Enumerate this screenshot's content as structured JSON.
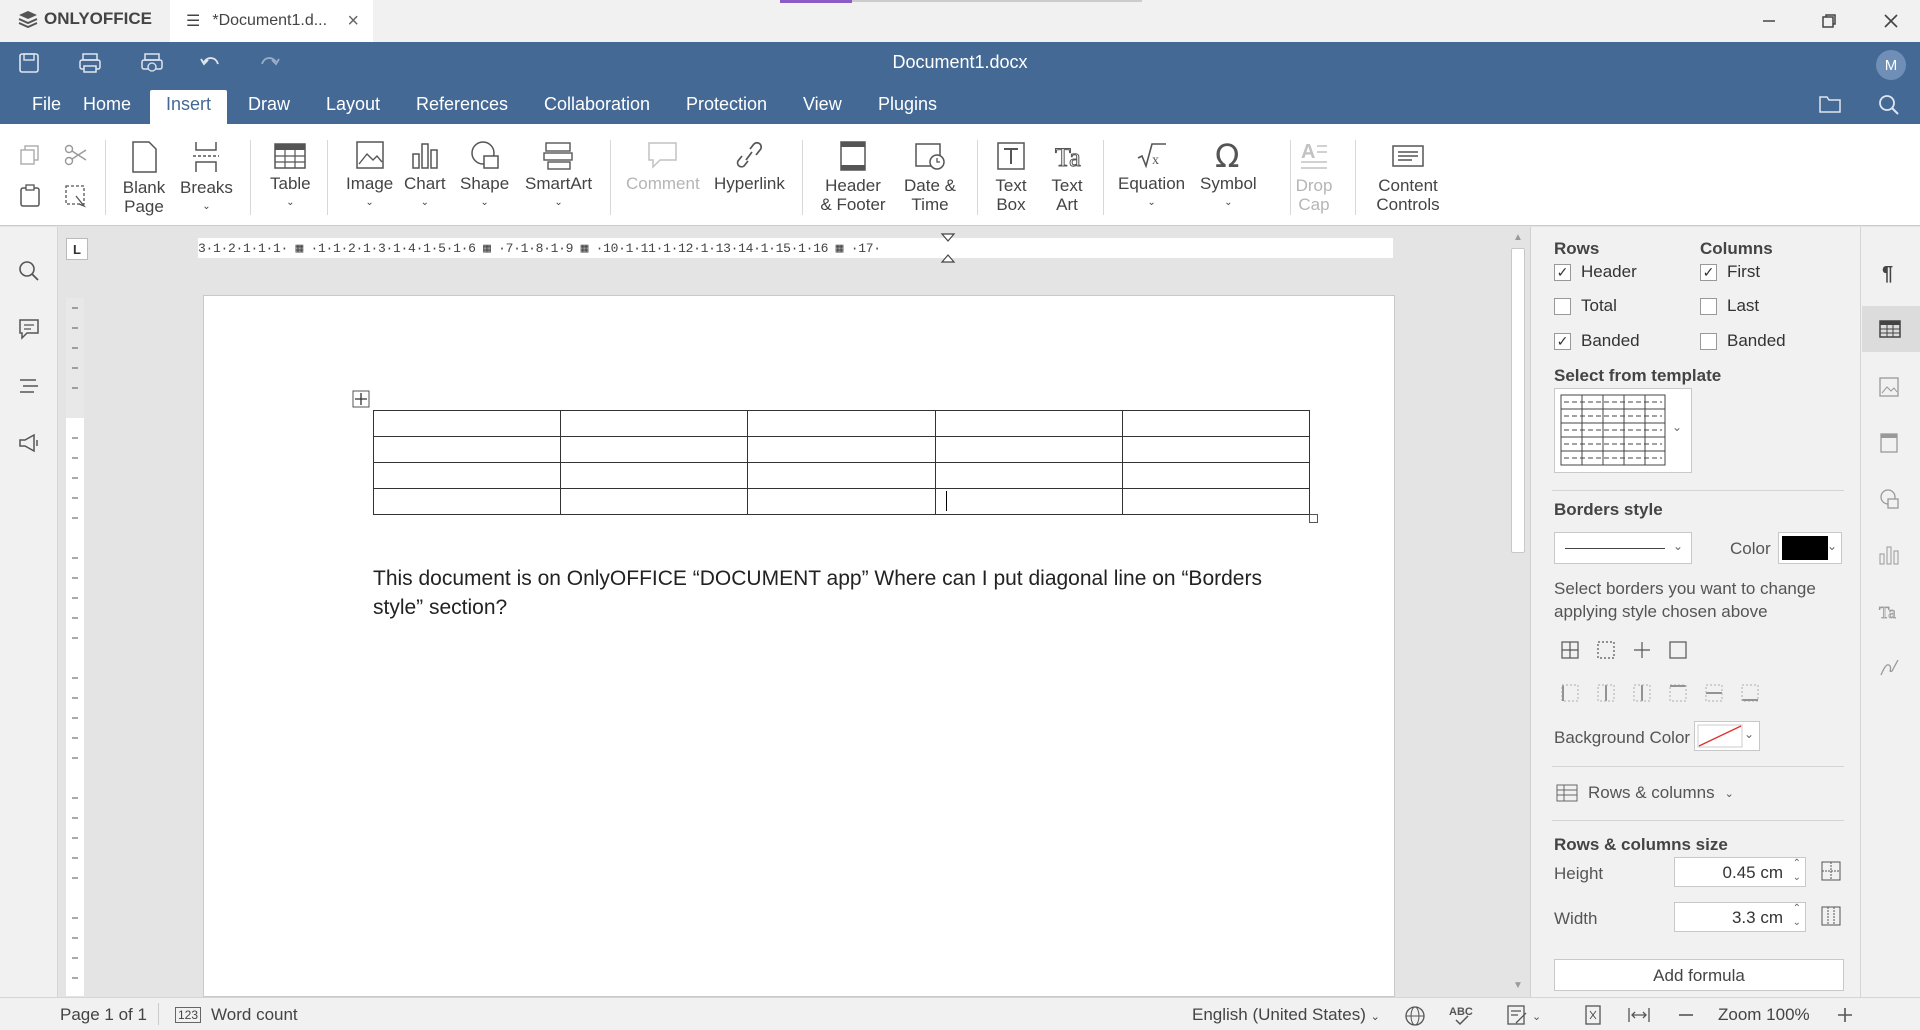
{
  "titlebar": {
    "brand": "ONLYOFFICE",
    "tab_title": "*Document1.d...",
    "close_tab": "×"
  },
  "header": {
    "doc_title": "Document1.docx",
    "avatar_initial": "M"
  },
  "tabs": [
    "File",
    "Home",
    "Insert",
    "Draw",
    "Layout",
    "References",
    "Collaboration",
    "Protection",
    "View",
    "Plugins"
  ],
  "toolbar": {
    "blank_page": "Blank Page",
    "breaks": "Breaks",
    "table": "Table",
    "image": "Image",
    "chart": "Chart",
    "shape": "Shape",
    "smartart": "SmartArt",
    "comment": "Comment",
    "hyperlink": "Hyperlink",
    "header_footer": "Header & Footer",
    "date_time": "Date & Time",
    "text_box": "Text Box",
    "text_art": "Text Art",
    "equation": "Equation",
    "symbol": "Symbol",
    "drop_cap": "Drop Cap",
    "content_controls": "Content Controls"
  },
  "ruler": {
    "h_text": "3·1·2·1·1·1· ▦ ·1·1·2·1·3·1·4·1·5·1·6 ▦ ·7·1·8·1·9 ▦ ·10·1·11·1·12·1·13·14·1·15·1·16 ▦ ·17·",
    "corner": "L"
  },
  "document": {
    "text": "This document is on OnlyOFFICE “DOCUMENT app” Where can I put diagonal line on “Borders style” section?"
  },
  "panel": {
    "rows_title": "Rows",
    "columns_title": "Columns",
    "rows": [
      {
        "label": "Header",
        "checked": true
      },
      {
        "label": "Total",
        "checked": false
      },
      {
        "label": "Banded",
        "checked": true
      }
    ],
    "columns": [
      {
        "label": "First",
        "checked": true
      },
      {
        "label": "Last",
        "checked": false
      },
      {
        "label": "Banded",
        "checked": false
      }
    ],
    "template_title": "Select from template",
    "borders_title": "Borders style",
    "color_label": "Color",
    "border_color": "#000000",
    "borders_hint": "Select borders you want to change applying style chosen above",
    "background_label": "Background Color",
    "rows_columns": "Rows & columns",
    "size_title": "Rows & columns size",
    "height_label": "Height",
    "height_value": "0.45 cm",
    "width_label": "Width",
    "width_value": "3.3 cm",
    "add_formula": "Add formula"
  },
  "status": {
    "page": "Page 1 of 1",
    "word_count": "Word count",
    "language": "English (United States)",
    "zoom": "Zoom 100%"
  },
  "colors": {
    "header": "#446995",
    "toolbar": "#ffffff",
    "panel": "#f1f1f1"
  }
}
